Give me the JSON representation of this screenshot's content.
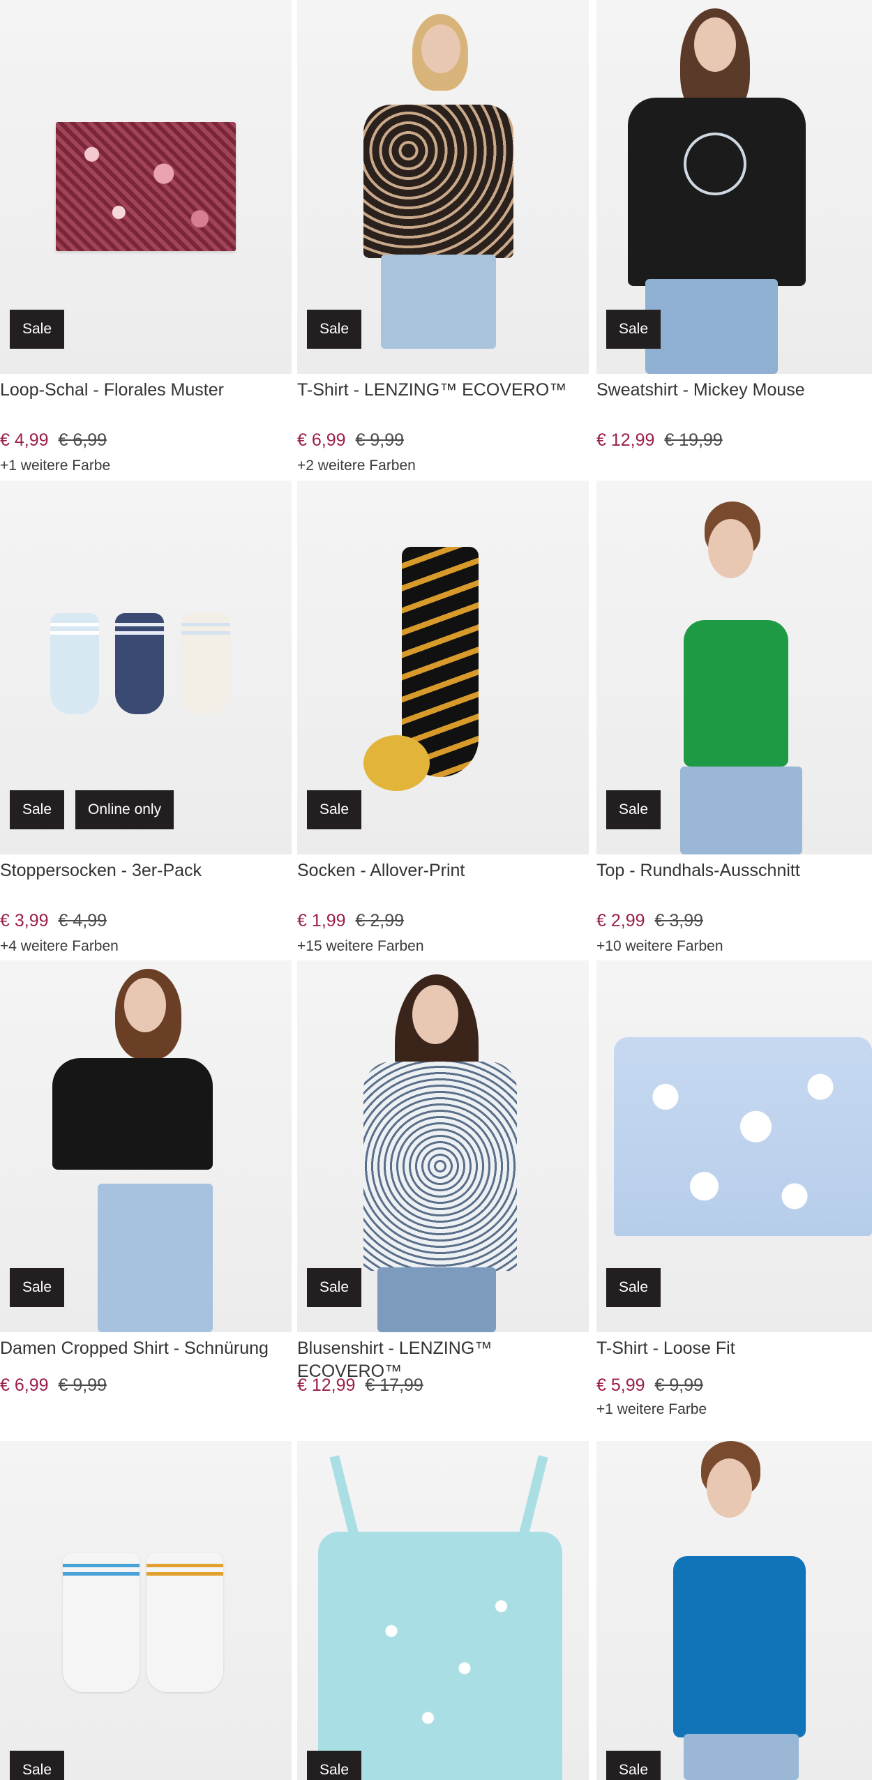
{
  "products": [
    {
      "title": "Loop-Schal - Florales Muster",
      "badges": [
        "Sale"
      ],
      "price_sale": "€ 4,99",
      "price_old": "€ 6,99",
      "colors": "+1 weitere Farbe"
    },
    {
      "title": "T-Shirt - LENZING™ ECOVERO™",
      "badges": [
        "Sale"
      ],
      "price_sale": "€ 6,99",
      "price_old": "€ 9,99",
      "colors": "+2 weitere Farben"
    },
    {
      "title": "Sweatshirt - Mickey Mouse",
      "badges": [
        "Sale"
      ],
      "price_sale": "€ 12,99",
      "price_old": "€ 19,99",
      "colors": ""
    },
    {
      "title": "Stoppersocken - 3er-Pack",
      "badges": [
        "Sale",
        "Online only"
      ],
      "price_sale": "€ 3,99",
      "price_old": "€ 4,99",
      "colors": "+4 weitere Farben"
    },
    {
      "title": "Socken - Allover-Print",
      "badges": [
        "Sale"
      ],
      "price_sale": "€ 1,99",
      "price_old": "€ 2,99",
      "colors": "+15 weitere Farben"
    },
    {
      "title": "Top - Rundhals-Ausschnitt",
      "badges": [
        "Sale"
      ],
      "price_sale": "€ 2,99",
      "price_old": "€ 3,99",
      "colors": "+10 weitere Farben"
    },
    {
      "title": "Damen Cropped Shirt - Schnürung",
      "badges": [
        "Sale"
      ],
      "price_sale": "€ 6,99",
      "price_old": "€ 9,99",
      "colors": ""
    },
    {
      "title": "Blusenshirt - LENZING™ ECOVERO™",
      "badges": [
        "Sale"
      ],
      "price_sale": "€ 12,99",
      "price_old": "€ 17,99",
      "colors": ""
    },
    {
      "title": "T-Shirt - Loose Fit",
      "badges": [
        "Sale"
      ],
      "price_sale": "€ 5,99",
      "price_old": "€ 9,99",
      "colors": "+1 weitere Farbe"
    },
    {
      "title": "",
      "badges": [
        "Sale"
      ],
      "price_sale": "",
      "price_old": "",
      "colors": ""
    },
    {
      "title": "",
      "badges": [
        "Sale"
      ],
      "price_sale": "",
      "price_old": "",
      "colors": ""
    },
    {
      "title": "",
      "badges": [
        "Sale"
      ],
      "price_sale": "",
      "price_old": "",
      "colors": ""
    }
  ],
  "colors": {
    "sale_price": "#9b1e4c",
    "badge_bg": "#231f20",
    "badge_text": "#ffffff"
  }
}
